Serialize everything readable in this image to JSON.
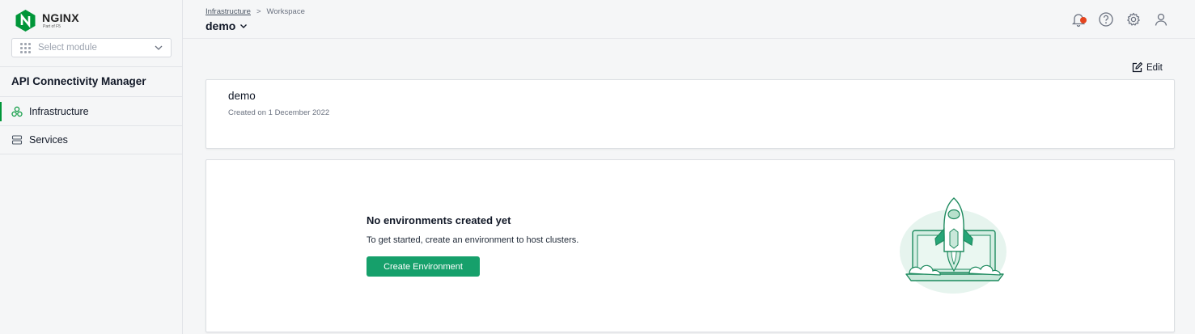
{
  "brand": {
    "name": "NGINX",
    "sub": "Part of F5",
    "accent": "#009639"
  },
  "sidebar": {
    "module_select_placeholder": "Select module",
    "app_title": "API Connectivity Manager",
    "items": [
      {
        "label": "Infrastructure",
        "icon": "cluster-icon",
        "active": true
      },
      {
        "label": "Services",
        "icon": "server-icon",
        "active": false
      }
    ]
  },
  "header": {
    "breadcrumb": [
      "Infrastructure",
      "Workspace"
    ],
    "breadcrumb_separator": ">",
    "title": "demo",
    "icons": [
      "notifications-icon",
      "help-icon",
      "settings-icon",
      "user-icon"
    ]
  },
  "main": {
    "edit_label": "Edit",
    "workspace": {
      "name": "demo",
      "created": "Created on 1 December 2022"
    },
    "empty_state": {
      "title": "No environments created yet",
      "description": "To get started, create an environment to host clusters.",
      "button_label": "Create Environment",
      "button_color": "#16a06b"
    }
  }
}
